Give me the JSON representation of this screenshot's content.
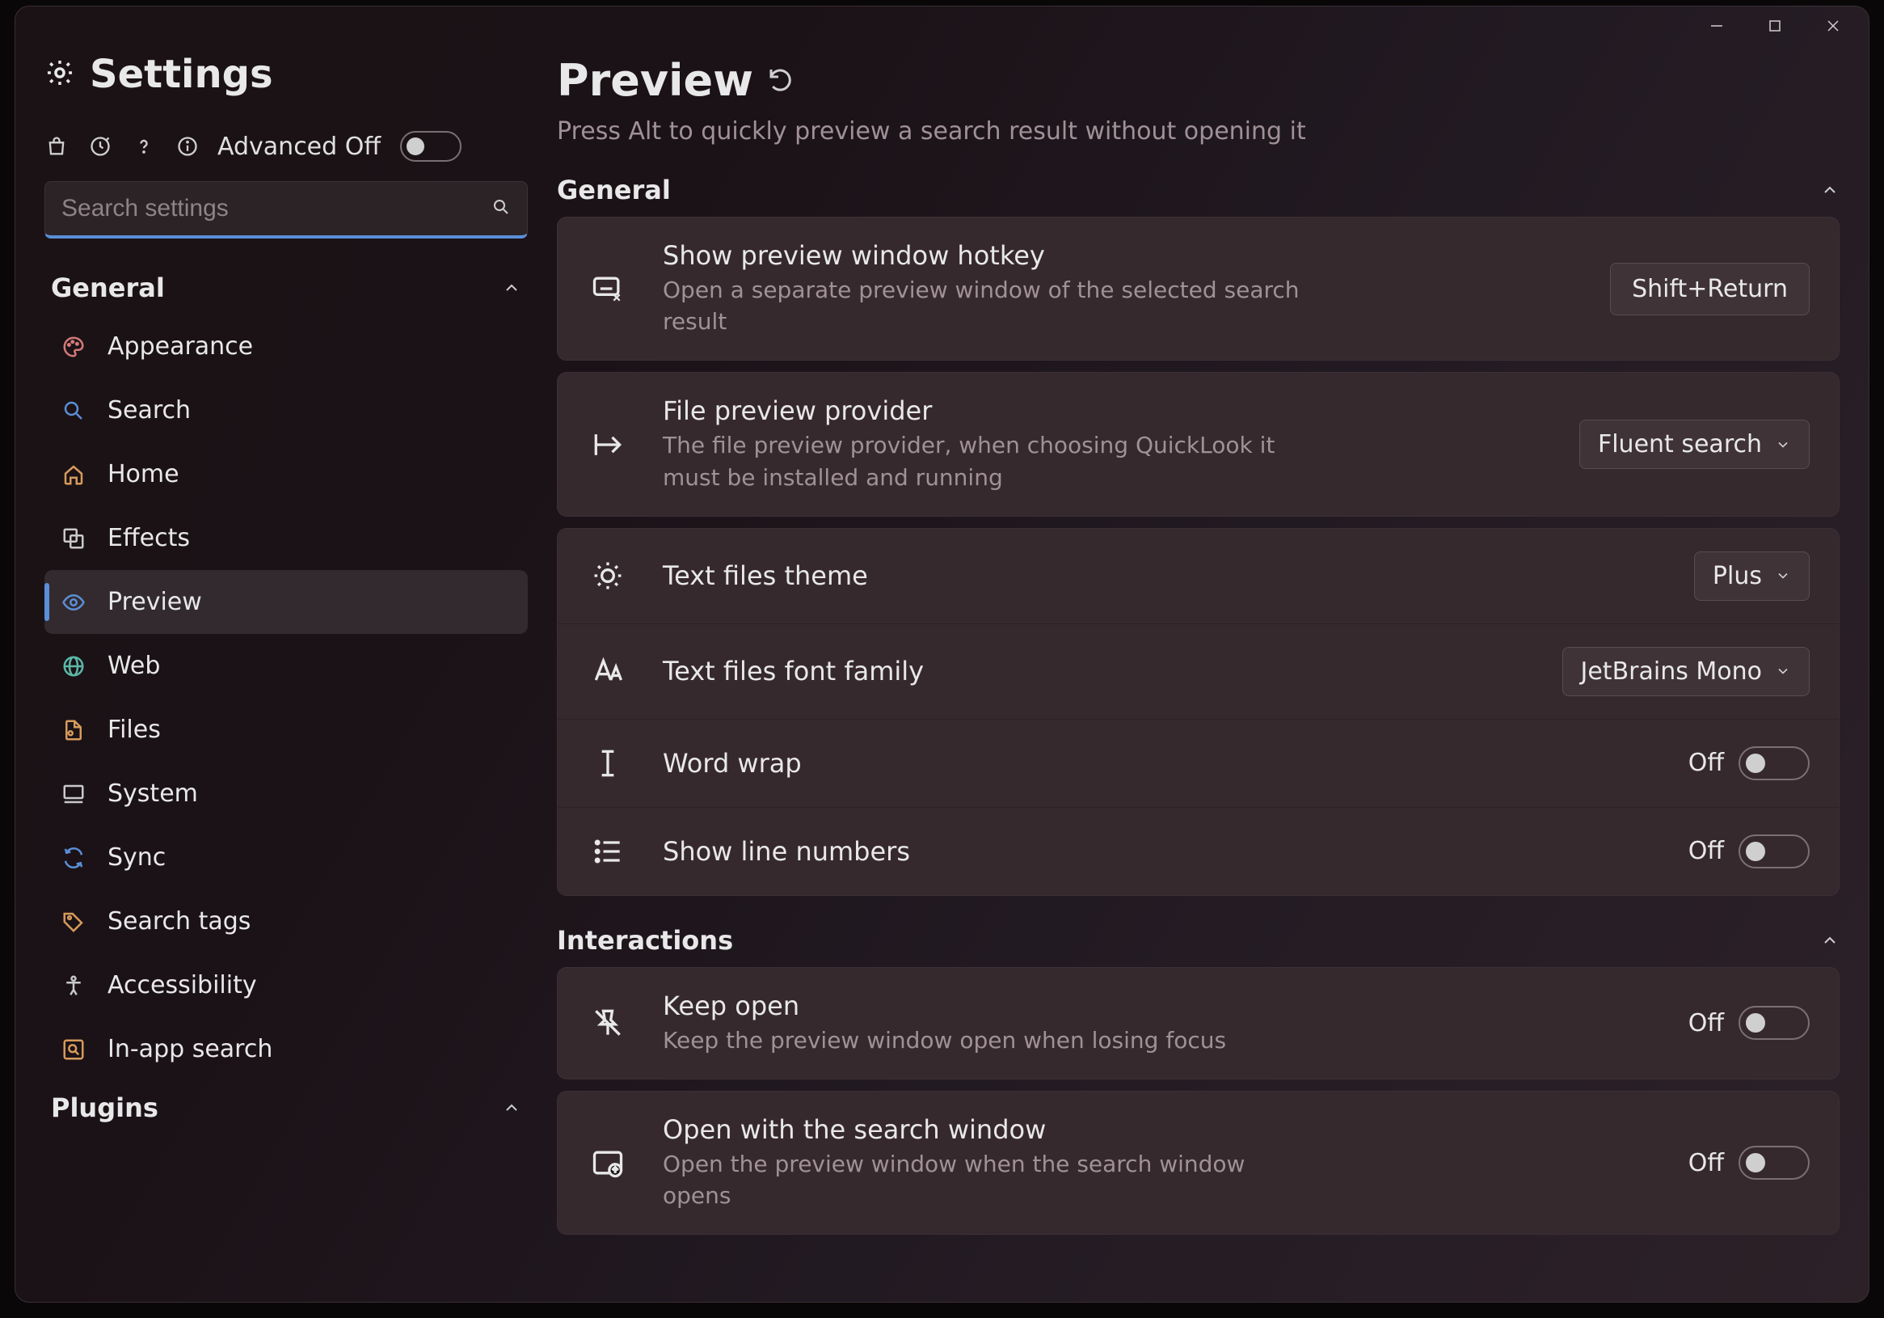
{
  "app_title": "Settings",
  "toolbar": {
    "advanced_label": "Advanced Off"
  },
  "search": {
    "placeholder": "Search settings"
  },
  "sidebar": {
    "sections": {
      "general": {
        "label": "General"
      },
      "plugins": {
        "label": "Plugins"
      }
    },
    "items": [
      {
        "id": "appearance",
        "label": "Appearance",
        "icon": "palette",
        "color": "#d47a7a"
      },
      {
        "id": "search",
        "label": "Search",
        "icon": "search",
        "color": "#5b8fd6"
      },
      {
        "id": "home",
        "label": "Home",
        "icon": "home",
        "color": "#d69b5b"
      },
      {
        "id": "effects",
        "label": "Effects",
        "icon": "effects",
        "color": "#c9c9c9"
      },
      {
        "id": "preview",
        "label": "Preview",
        "icon": "eye",
        "color": "#5b8fd6",
        "active": true
      },
      {
        "id": "web",
        "label": "Web",
        "icon": "globe",
        "color": "#5bb8a8"
      },
      {
        "id": "files",
        "label": "Files",
        "icon": "file",
        "color": "#d69b5b"
      },
      {
        "id": "system",
        "label": "System",
        "icon": "monitor",
        "color": "#c9c9c9"
      },
      {
        "id": "sync",
        "label": "Sync",
        "icon": "sync",
        "color": "#5b8fd6"
      },
      {
        "id": "searchtags",
        "label": "Search tags",
        "icon": "tag",
        "color": "#d69b5b"
      },
      {
        "id": "accessibility",
        "label": "Accessibility",
        "icon": "access",
        "color": "#c9c9c9"
      },
      {
        "id": "inapp",
        "label": "In-app search",
        "icon": "inapp",
        "color": "#d69b5b"
      }
    ]
  },
  "page": {
    "title": "Preview",
    "subtitle": "Press Alt to quickly preview a search result without opening it"
  },
  "sections": {
    "general": {
      "title": "General"
    },
    "interactions": {
      "title": "Interactions"
    }
  },
  "settings": {
    "hotkey": {
      "title": "Show preview window hotkey",
      "desc": "Open a separate preview window of the selected search result",
      "value": "Shift+Return"
    },
    "provider": {
      "title": "File preview provider",
      "desc": "The file preview provider, when choosing QuickLook it must be installed and running",
      "value": "Fluent search"
    },
    "theme": {
      "title": "Text files theme",
      "value": "Plus"
    },
    "font": {
      "title": "Text files font family",
      "value": "JetBrains Mono"
    },
    "wrap": {
      "title": "Word wrap",
      "state": "Off"
    },
    "lineno": {
      "title": "Show line numbers",
      "state": "Off"
    },
    "keepopen": {
      "title": "Keep open",
      "desc": "Keep the preview window open when losing focus",
      "state": "Off"
    },
    "openwith": {
      "title": "Open with the search window",
      "desc": "Open the preview window when the search window opens",
      "state": "Off"
    }
  }
}
